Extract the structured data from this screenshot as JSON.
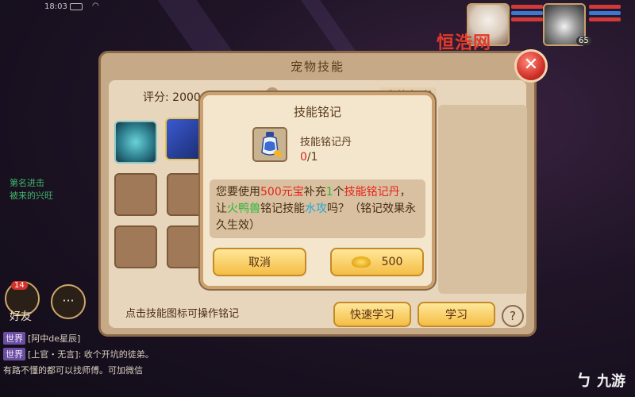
{
  "status_bar": {
    "time": "18:03"
  },
  "watermark": "恒浩网",
  "enemy_level": "65",
  "panel": {
    "title": "宠物技能",
    "score_label": "评分: 2000",
    "bag_title": "我的包裹",
    "hint": "点击技能图标可操作铭记",
    "quick_learn_button": "快速学习",
    "learn_button": "学习",
    "help_button": "?",
    "close_button": "✕"
  },
  "dialog": {
    "title": "技能铭记",
    "item_name": "技能铭记丹",
    "item_have": "0",
    "item_need": "/1",
    "message": {
      "p1": "您要使用",
      "cost": "500元宝",
      "p2": "补充",
      "count": "1",
      "p3": "个",
      "item": "技能铭记丹",
      "p4": "，让",
      "pet": "火鸭兽",
      "p5": "铭记技能",
      "skill": "水攻",
      "p6": "吗？（铭记效果永久生效）"
    },
    "cancel_button": "取消",
    "confirm_amount": "500"
  },
  "left_overlay": {
    "line1": "第名进击",
    "line2": "被来的兴旺"
  },
  "friends_label": "好友",
  "friends_badge": "14",
  "chat": [
    {
      "tag": "世界",
      "text": "[阿中de星辰]"
    },
    {
      "tag": "世界",
      "text": "[上官・无言]: 收个开坑的徒弟。"
    },
    {
      "tag": "",
      "text": "有路不懂的都可以找师傅。可加微信"
    }
  ],
  "brand": "九游"
}
